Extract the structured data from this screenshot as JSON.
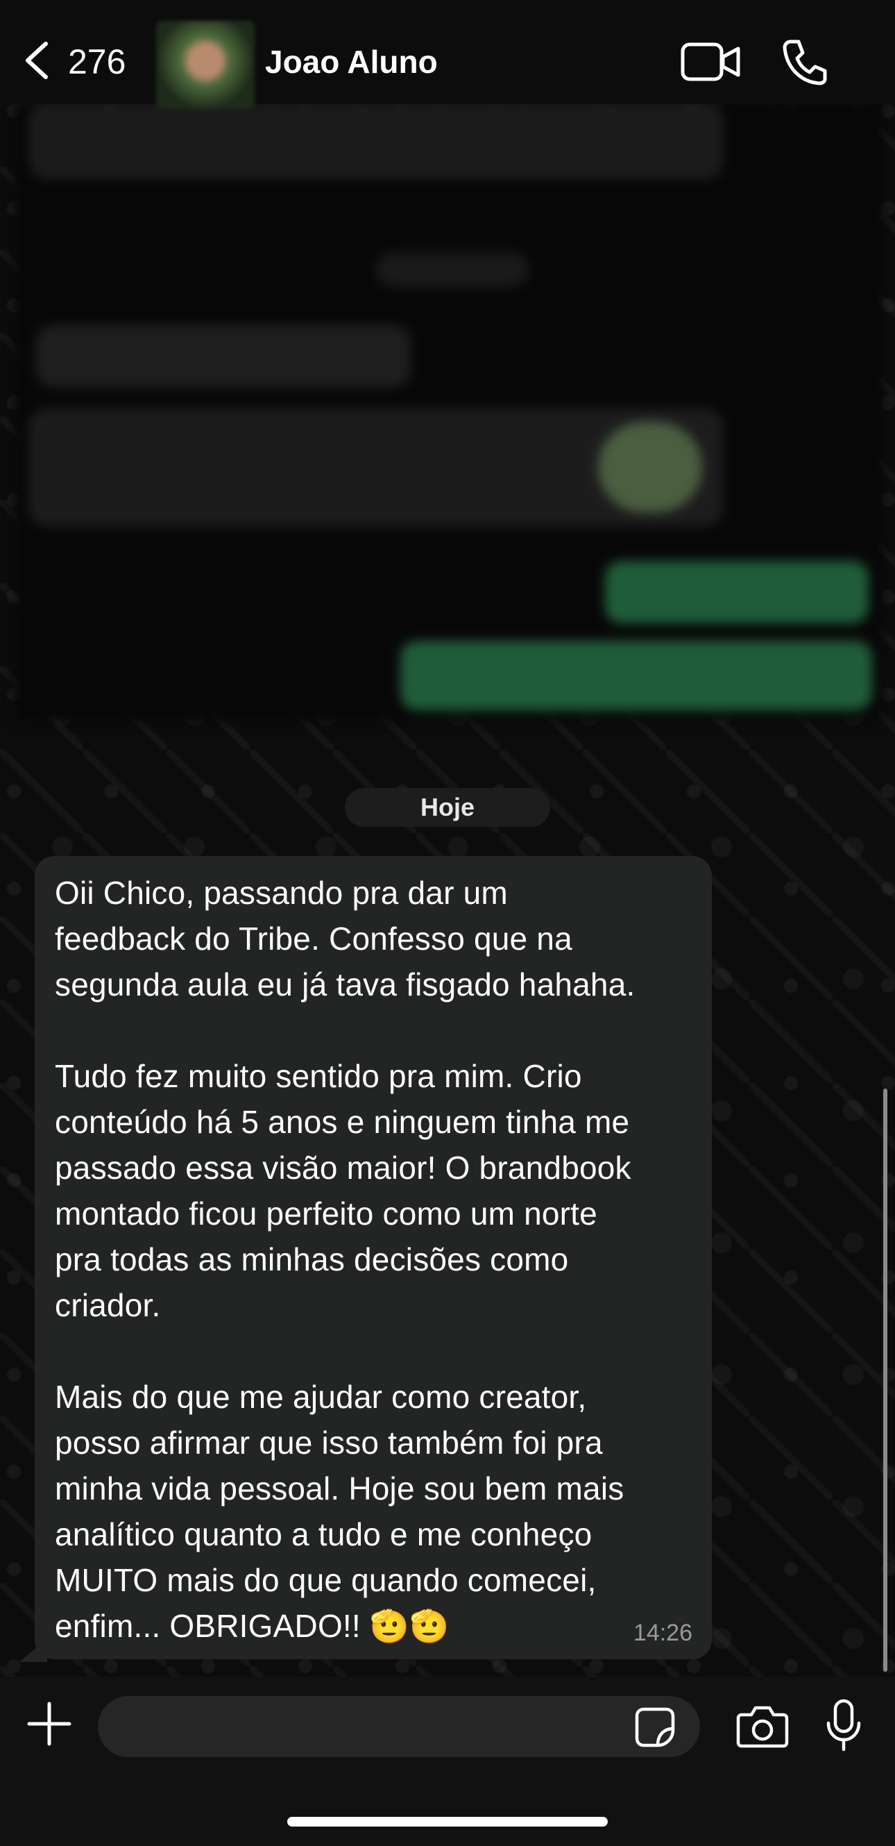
{
  "header": {
    "back_count": "276",
    "contact_name": "Joao Aluno"
  },
  "date_separator": "Hoje",
  "message": {
    "paragraphs": [
      "Oii Chico, passando pra dar um\nfeedback do Tribe. Confesso que na\nsegunda aula eu já tava fisgado hahaha.",
      "Tudo fez muito sentido pra mim. Crio\nconteúdo há 5 anos e ninguem tinha me\npassado essa visão maior! O brandbook\nmontado ficou perfeito como um norte\npra todas as minhas decisões como\ncriador.",
      "Mais do que me ajudar como creator,\nposso afirmar que isso também foi pra\nminha vida pessoal. Hoje sou bem mais\nanalítico quanto a tudo e me conheço\nMUITO mais do que quando comecei,\nenfim... OBRIGADO!! 🫡🫡"
    ],
    "time": "14:26"
  },
  "composer": {
    "value": ""
  },
  "icons": {
    "back": "chevron-left-icon",
    "video": "video-camera-icon",
    "call": "phone-icon",
    "plus": "plus-icon",
    "sticker": "sticker-icon",
    "camera": "camera-icon",
    "mic": "microphone-icon"
  },
  "colors": {
    "background": "#0b0b0b",
    "bubble_incoming": "#232424",
    "outgoing_green": "#1f5c3a",
    "time_text": "#9a9a9a"
  }
}
